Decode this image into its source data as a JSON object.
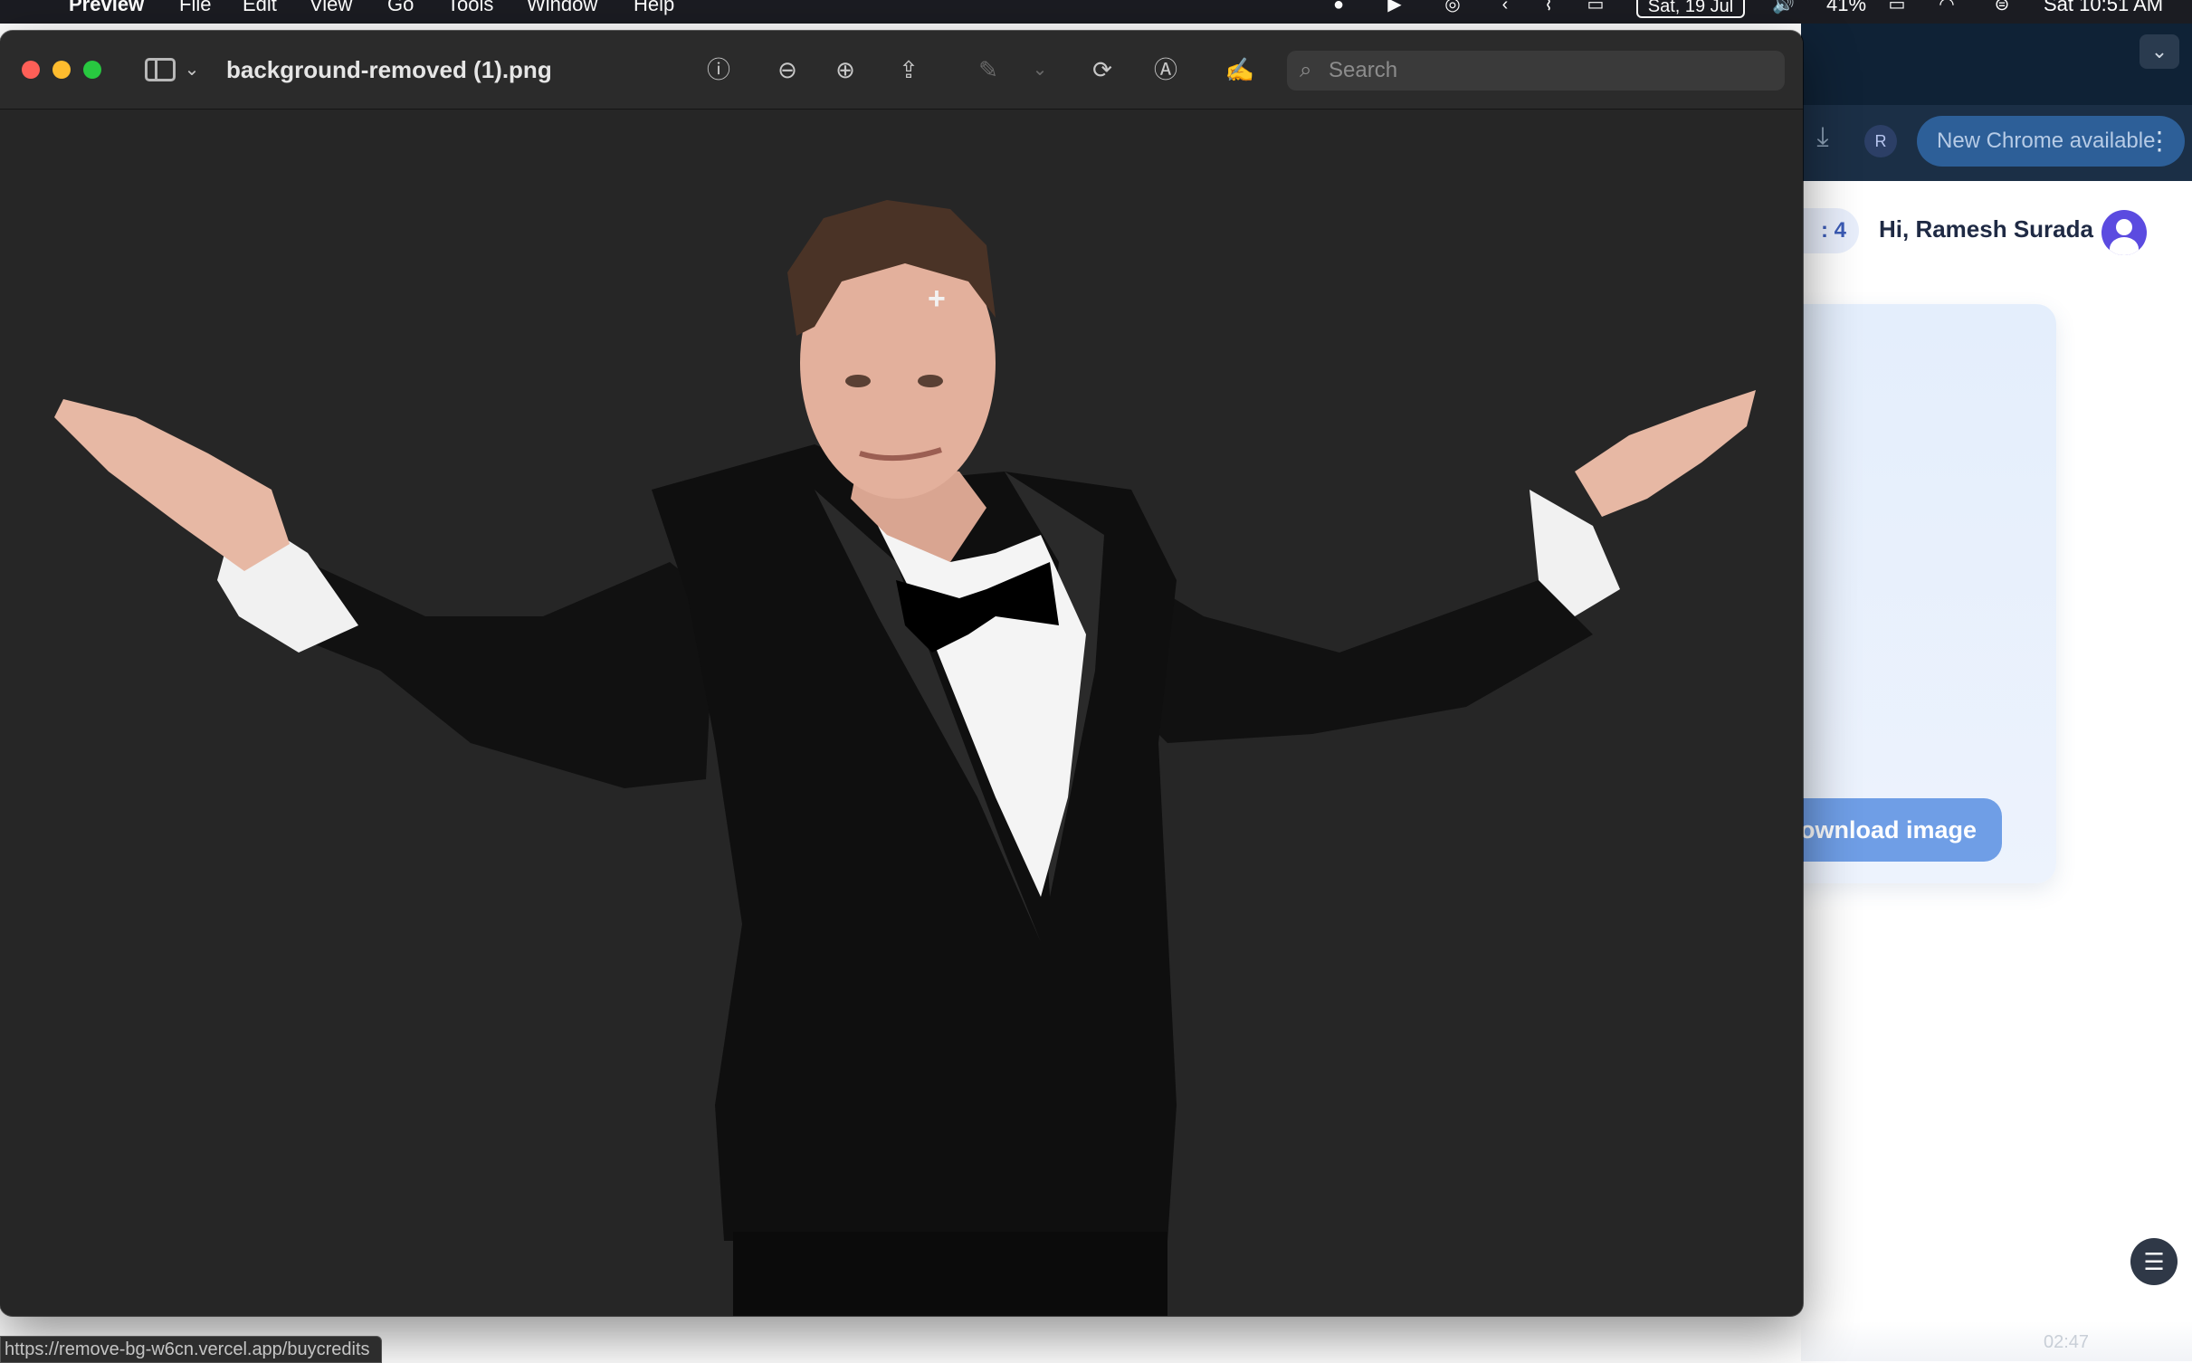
{
  "menubar": {
    "app_name": "Preview",
    "menus": [
      "File",
      "Edit",
      "View",
      "Go",
      "Tools",
      "Window",
      "Help"
    ],
    "date_pill": "Sat, 19 Jul",
    "battery": "41%",
    "clock": "Sat 10:51 AM"
  },
  "preview": {
    "document_title": "background-removed (1).png",
    "search_placeholder": "Search",
    "toolbar_icons": [
      "info-icon",
      "zoom-out-icon",
      "zoom-in-icon",
      "share-icon",
      "highlight-pen-icon",
      "rotate-icon",
      "markup-icon",
      "sign-icon"
    ],
    "image_subject": "Man in black tuxedo with bow tie, arms spread in a shrug, background removed"
  },
  "chrome": {
    "new_chrome_label": "New Chrome available",
    "profile_initial": "R",
    "credits_text": ": 4",
    "greeting": "Hi, Ramesh Surada",
    "download_button": "Download image",
    "timecode": "02:47"
  },
  "status_url": "https://remove-bg-w6cn.vercel.app/buycredits",
  "colors": {
    "preview_bg": "#262626",
    "chrome_tabbar": "#0f2236",
    "download_button": "#6f9ee6",
    "avatar": "#5b4be0"
  }
}
